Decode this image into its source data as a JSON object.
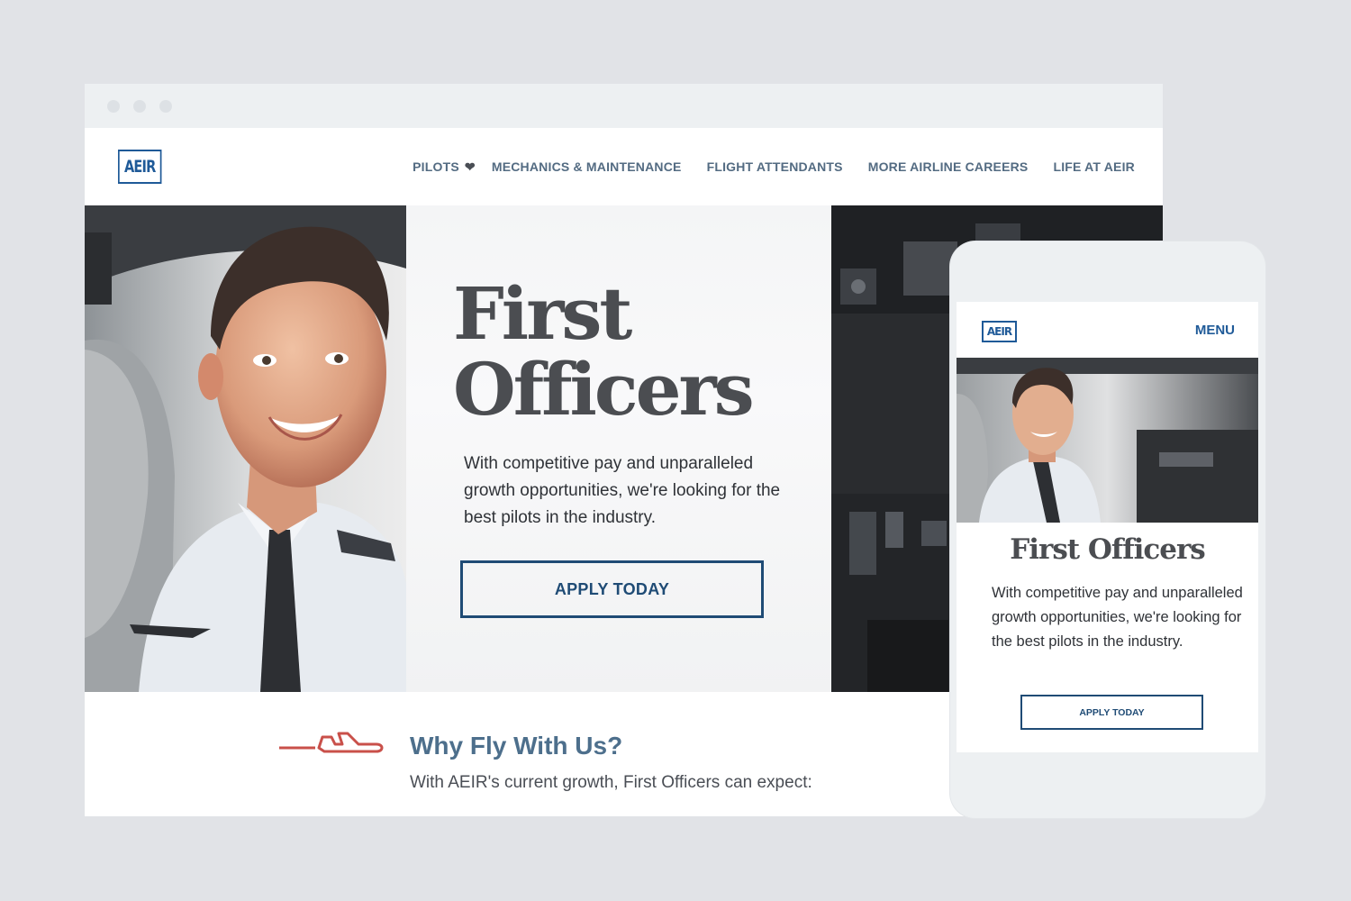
{
  "colors": {
    "brand_blue": "#1f5a98",
    "nav_gray_blue": "#536b82",
    "heading_gray": "#4b4d51",
    "accent_red": "#c9504a",
    "button_navy": "#1f4b75"
  },
  "desktop": {
    "logo": "AEIR",
    "nav": {
      "pilots": "PILOTS",
      "pilots_icon": "heart-icon",
      "mechanics": "MECHANICS & MAINTENANCE",
      "flight_attendants": "FLIGHT ATTENDANTS",
      "more_careers": "MORE AIRLINE CAREERS",
      "life": "LIFE AT AEIR"
    },
    "hero": {
      "title_line1": "First",
      "title_line2": "Officers",
      "text": "With competitive pay and unparalleled growth opportunities, we're looking for the best pilots in the industry.",
      "button": "APPLY TODAY"
    },
    "why": {
      "icon": "plane-icon",
      "title": "Why Fly With Us?",
      "text": "With AEIR's current growth, First Officers can expect:"
    }
  },
  "mobile": {
    "logo": "AEIR",
    "menu": "MENU",
    "title": "First Officers",
    "text": "With competitive pay and unparalleled growth opportunities, we're looking for the best pilots in the industry.",
    "button": "APPLY TODAY"
  }
}
